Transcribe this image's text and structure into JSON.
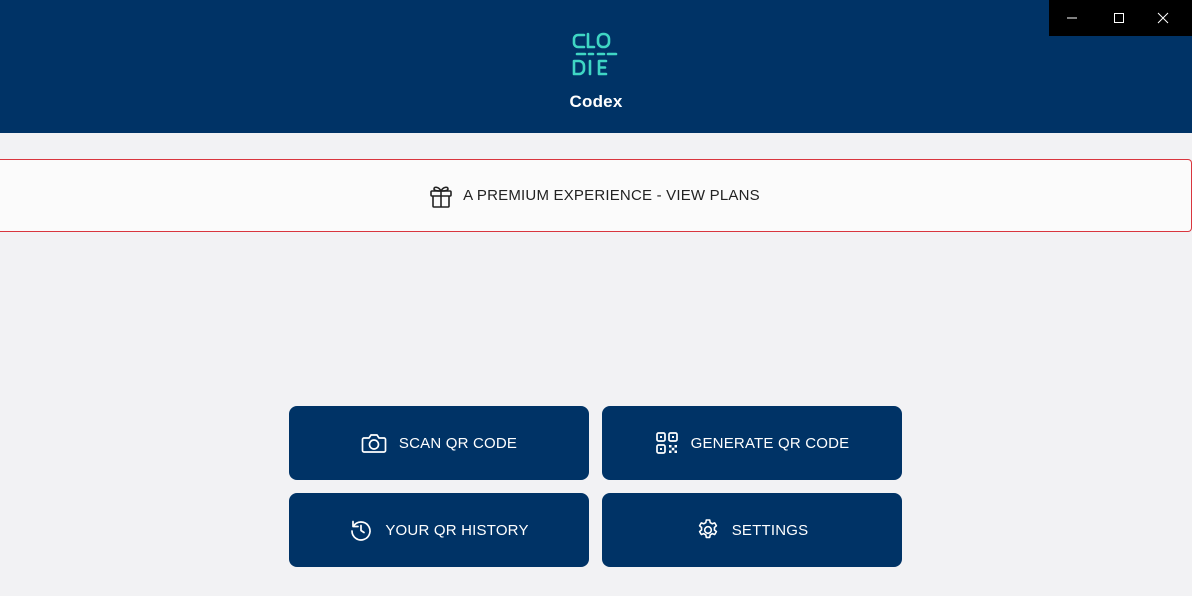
{
  "app": {
    "title": "Codex",
    "logo_text": "CODE"
  },
  "window_controls": {
    "minimize_icon": "minimize-icon",
    "maximize_icon": "maximize-icon",
    "close_icon": "close-icon"
  },
  "promo": {
    "label": "A PREMIUM EXPERIENCE - VIEW PLANS",
    "icon": "gift-icon"
  },
  "actions": [
    {
      "label": "SCAN QR CODE",
      "icon": "camera-icon"
    },
    {
      "label": "GENERATE QR CODE",
      "icon": "qr-code-icon"
    },
    {
      "label": "YOUR QR HISTORY",
      "icon": "history-icon"
    },
    {
      "label": "SETTINGS",
      "icon": "gear-icon"
    }
  ],
  "colors": {
    "header_bg": "#003366",
    "button_bg": "#003366",
    "page_bg": "#f2f2f4",
    "promo_border": "#d9363e",
    "logo_accent": "#3fd6c4"
  }
}
